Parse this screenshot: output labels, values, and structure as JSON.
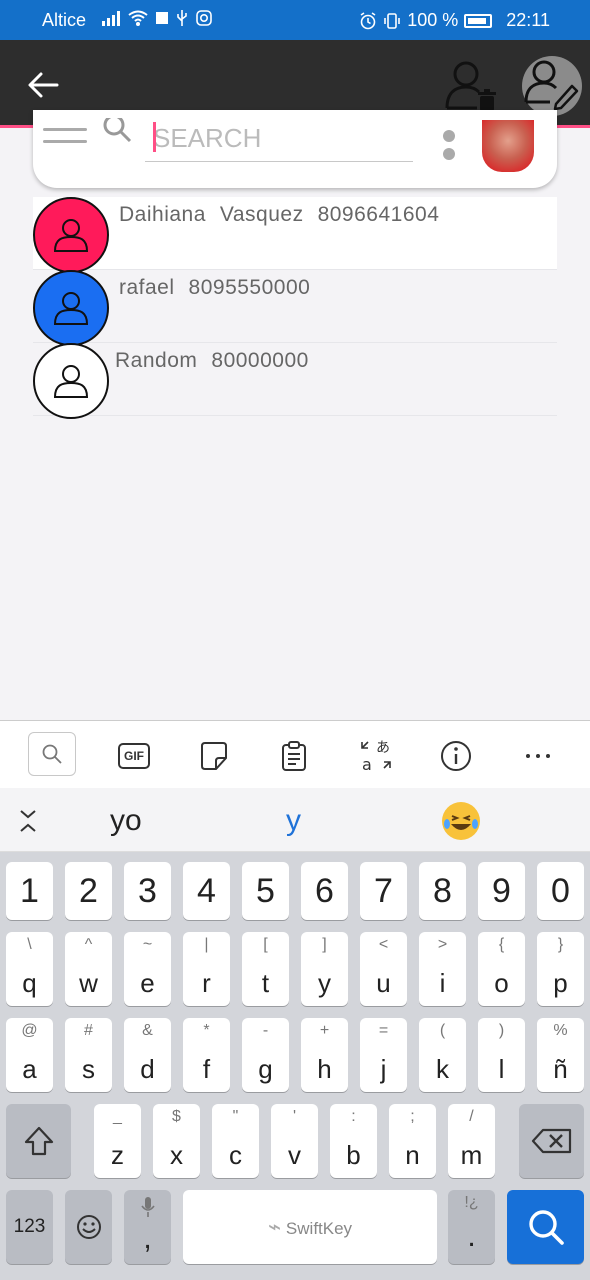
{
  "status_bar": {
    "carrier": "Altice",
    "battery": "100 %",
    "time": "22:11"
  },
  "app_bar": {
    "back_icon": "arrow-left-icon",
    "delete_contact_icon": "person-trash-icon",
    "edit_contact_icon": "person-edit-icon"
  },
  "search": {
    "placeholder": "SEARCH",
    "value": ""
  },
  "contacts": [
    {
      "first": "Daihiana",
      "last": "Vasquez",
      "phone": "8096641604",
      "color": "#ff1a5a"
    },
    {
      "first": "rafael",
      "last": "",
      "phone": "8095550000",
      "color": "#1a6ef2"
    },
    {
      "first": "Random",
      "last": "",
      "phone": "80000000",
      "color": "#ffffff"
    }
  ],
  "keyboard": {
    "suggestions": [
      "yo",
      "y"
    ],
    "number_row": [
      "1",
      "2",
      "3",
      "4",
      "5",
      "6",
      "7",
      "8",
      "9",
      "0"
    ],
    "row1": [
      {
        "sub": "\\",
        "main": "q"
      },
      {
        "sub": "^",
        "main": "w"
      },
      {
        "sub": "~",
        "main": "e"
      },
      {
        "sub": "|",
        "main": "r"
      },
      {
        "sub": "[",
        "main": "t"
      },
      {
        "sub": "]",
        "main": "y"
      },
      {
        "sub": "<",
        "main": "u"
      },
      {
        "sub": ">",
        "main": "i"
      },
      {
        "sub": "{",
        "main": "o"
      },
      {
        "sub": "}",
        "main": "p"
      }
    ],
    "row2": [
      {
        "sub": "@",
        "main": "a"
      },
      {
        "sub": "#",
        "main": "s"
      },
      {
        "sub": "&",
        "main": "d"
      },
      {
        "sub": "*",
        "main": "f"
      },
      {
        "sub": "-",
        "main": "g"
      },
      {
        "sub": "+",
        "main": "h"
      },
      {
        "sub": "=",
        "main": "j"
      },
      {
        "sub": "(",
        "main": "k"
      },
      {
        "sub": ")",
        "main": "l"
      },
      {
        "sub": "%",
        "main": "ñ"
      }
    ],
    "row3": [
      {
        "sub": "_",
        "main": "z"
      },
      {
        "sub": "$",
        "main": "x"
      },
      {
        "sub": "\"",
        "main": "c"
      },
      {
        "sub": "'",
        "main": "v"
      },
      {
        "sub": ":",
        "main": "b"
      },
      {
        "sub": ";",
        "main": "n"
      },
      {
        "sub": "/",
        "main": "m"
      }
    ],
    "bottom": {
      "numbers_label": "123",
      "comma": ",",
      "space_brand": "SwiftKey",
      "period": ".",
      "period_sub": "!¿"
    }
  }
}
